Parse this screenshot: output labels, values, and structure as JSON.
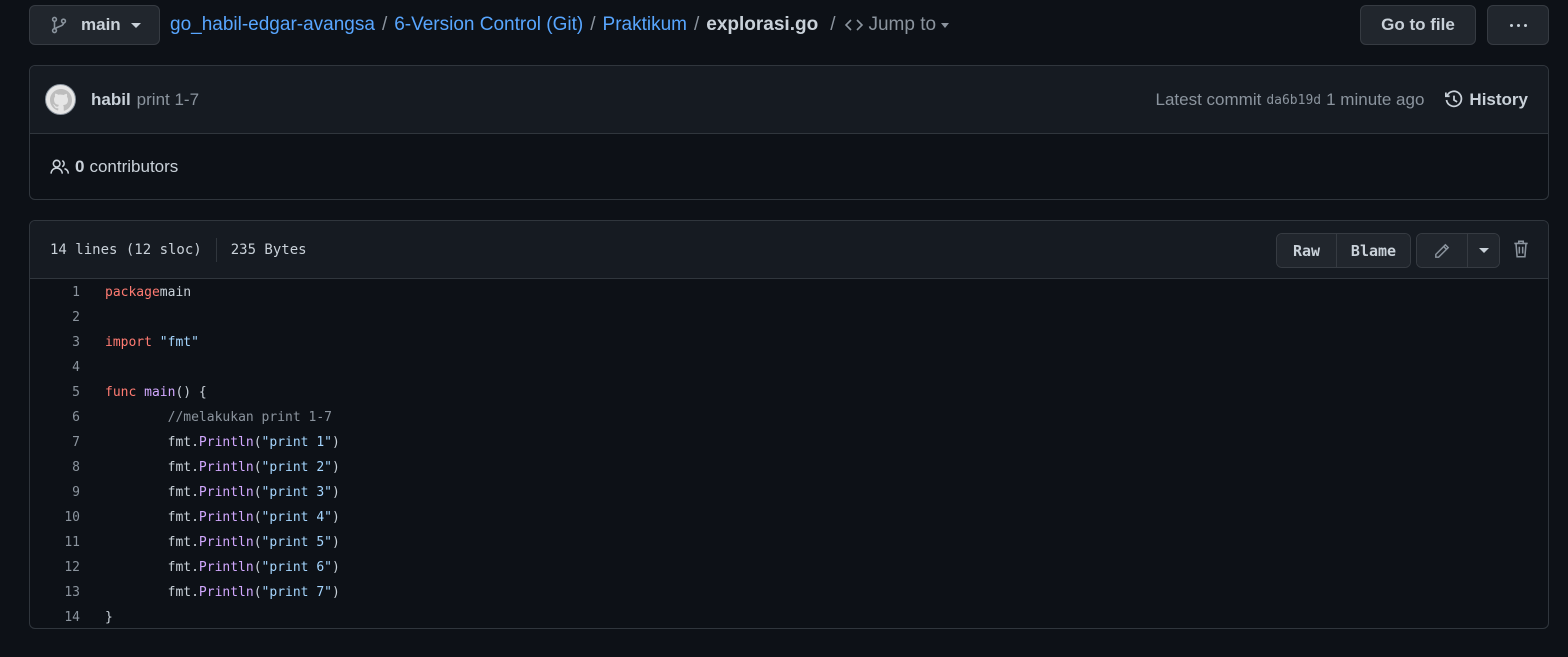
{
  "branch": {
    "label": "main"
  },
  "breadcrumb": {
    "repo": "go_habil-edgar-avangsa",
    "folder1": "6-Version Control (Git)",
    "folder2": "Praktikum",
    "file": "explorasi.go",
    "separator": "/",
    "jump_label": "Jump to"
  },
  "actions": {
    "go_to_file": "Go to file"
  },
  "commit": {
    "author": "habil",
    "message": "print 1-7",
    "latest_label": "Latest commit",
    "sha": "da6b19d",
    "time": "1 minute ago",
    "history_label": "History"
  },
  "contributors": {
    "count": "0",
    "label": "contributors"
  },
  "file_info": {
    "lines": "14 lines (12 sloc)",
    "size": "235 Bytes"
  },
  "file_actions": {
    "raw": "Raw",
    "blame": "Blame"
  },
  "code_lines": [
    {
      "n": "1",
      "tokens": [
        [
          "kw",
          "package"
        ],
        [
          "",
          "main"
        ]
      ]
    },
    {
      "n": "2",
      "tokens": []
    },
    {
      "n": "3",
      "tokens": [
        [
          "kw",
          "import"
        ],
        [
          "",
          ""
        ],
        [
          "str",
          "\"fmt\""
        ]
      ]
    },
    {
      "n": "4",
      "tokens": []
    },
    {
      "n": "5",
      "tokens": [
        [
          "kw",
          "func"
        ],
        [
          "",
          ""
        ],
        [
          "fn",
          "main"
        ],
        [
          "",
          "() {"
        ]
      ]
    },
    {
      "n": "6",
      "tokens": [
        [
          "",
          "\t"
        ],
        [
          "cm",
          "//melakukan print 1-7"
        ]
      ]
    },
    {
      "n": "7",
      "tokens": [
        [
          "",
          "\tfmt."
        ],
        [
          "fn",
          "Println"
        ],
        [
          "",
          "("
        ],
        [
          "str",
          "\"print 1\""
        ],
        [
          "",
          ")"
        ]
      ]
    },
    {
      "n": "8",
      "tokens": [
        [
          "",
          "\tfmt."
        ],
        [
          "fn",
          "Println"
        ],
        [
          "",
          "("
        ],
        [
          "str",
          "\"print 2\""
        ],
        [
          "",
          ")"
        ]
      ]
    },
    {
      "n": "9",
      "tokens": [
        [
          "",
          "\tfmt."
        ],
        [
          "fn",
          "Println"
        ],
        [
          "",
          "("
        ],
        [
          "str",
          "\"print 3\""
        ],
        [
          "",
          ")"
        ]
      ]
    },
    {
      "n": "10",
      "tokens": [
        [
          "",
          "\tfmt."
        ],
        [
          "fn",
          "Println"
        ],
        [
          "",
          "("
        ],
        [
          "str",
          "\"print 4\""
        ],
        [
          "",
          ")"
        ]
      ]
    },
    {
      "n": "11",
      "tokens": [
        [
          "",
          "\tfmt."
        ],
        [
          "fn",
          "Println"
        ],
        [
          "",
          "("
        ],
        [
          "str",
          "\"print 5\""
        ],
        [
          "",
          ")"
        ]
      ]
    },
    {
      "n": "12",
      "tokens": [
        [
          "",
          "\tfmt."
        ],
        [
          "fn",
          "Println"
        ],
        [
          "",
          "("
        ],
        [
          "str",
          "\"print 6\""
        ],
        [
          "",
          ")"
        ]
      ]
    },
    {
      "n": "13",
      "tokens": [
        [
          "",
          "\tfmt."
        ],
        [
          "fn",
          "Println"
        ],
        [
          "",
          "("
        ],
        [
          "str",
          "\"print 7\""
        ],
        [
          "",
          ")"
        ]
      ]
    },
    {
      "n": "14",
      "tokens": [
        [
          "",
          "}"
        ]
      ]
    }
  ],
  "icons": {
    "branch": "git-branch-icon",
    "code": "code-icon",
    "avatar": "github-avatar-icon",
    "history": "history-icon",
    "people": "people-icon",
    "pencil": "pencil-icon",
    "trash": "trash-icon",
    "more": "kebab-horizontal-icon"
  },
  "colors": {
    "background": "#0d1117",
    "panel": "#161b22",
    "border": "#30363d",
    "link": "#58a6ff",
    "keyword": "#ff7b72",
    "function": "#d2a8ff",
    "string": "#a5d6ff",
    "comment": "#8b949e"
  }
}
